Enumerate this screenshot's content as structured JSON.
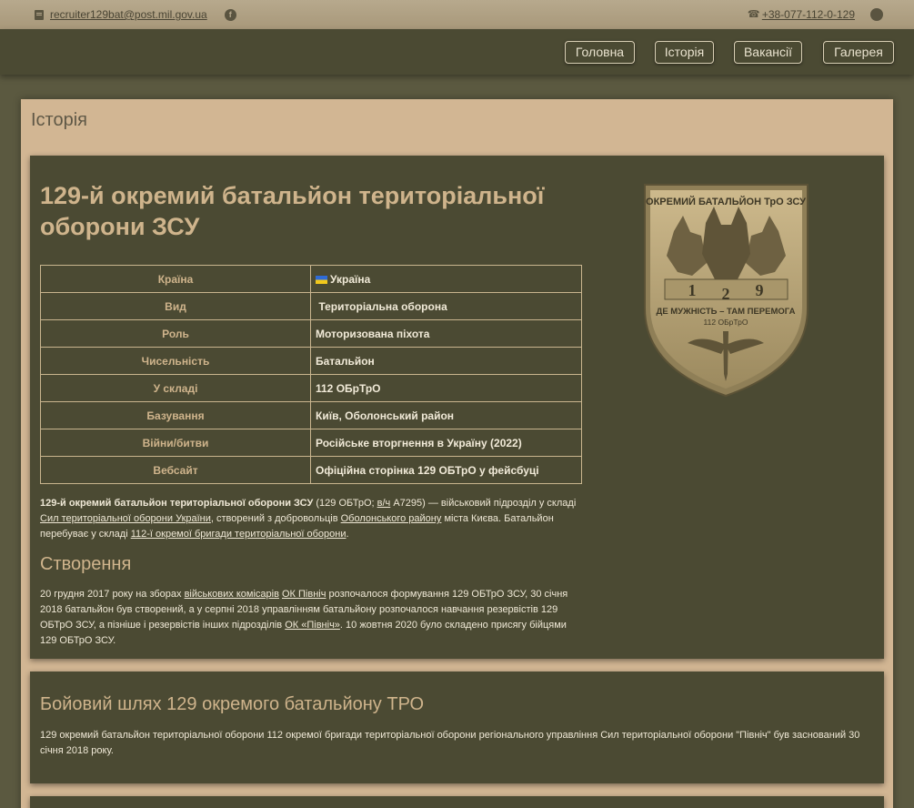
{
  "topbar": {
    "email": "recruiter129bat@post.mil.gov.ua",
    "phone": "+38-077-112-0-129",
    "icons": [
      "mail-icon",
      "facebook-icon",
      "phone-icon",
      "whatsapp-icon"
    ]
  },
  "nav": {
    "items": [
      "Головна",
      "Історія",
      "Вакансії",
      "Галерея"
    ]
  },
  "page_title": "Історія",
  "article": {
    "title": "129-й окремий батальйон територіальної оборони ЗСУ",
    "infobox": [
      {
        "key": "Країна",
        "value": "Україна"
      },
      {
        "key": "Вид",
        "value": "Територіальна оборона"
      },
      {
        "key": "Роль",
        "value": "Моторизована піхота"
      },
      {
        "key": "Чисельність",
        "value": "Батальйон"
      },
      {
        "key": "У складі",
        "value": "112 ОБрТрО"
      },
      {
        "key": "Базування",
        "value": "Київ, Оболонський район"
      },
      {
        "key": "Війни/битви",
        "value": "Російське вторгнення в Україну (2022)"
      },
      {
        "key": "Вебсайт",
        "value": "Офіційна сторінка 129 ОБТрО у фейсбуці"
      }
    ],
    "intro": {
      "bold": "129-й окремий батальйон територіальної оборони ЗСУ",
      "t1": " (129 ОБТрО; ",
      "l1": "в/ч",
      "t2": " А7295) — військовий підрозділ у складі ",
      "l2": "Сил територіальної оборони України",
      "t3": ", створений з добровольців ",
      "l3": "Оболонського району",
      "t4": " міста Києва. Батальйон перебуває у складі ",
      "l4": "112-ї окремої бригади територіальної оборони",
      "t5": "."
    },
    "section1_title": "Створення",
    "section1": {
      "t1": "20 грудня 2017 року на зборах ",
      "l1": "військових комісарів",
      "t2": " ",
      "l2": "ОК Північ",
      "t3": " розпочалося формування 129 ОБТрО ЗСУ, 30 січня 2018 батальйон був створений, а у серпні 2018 управлінням батальйону розпочалося навчання резервістів 129 ОБТрО ЗСУ, а пізніше і резервістів інших підрозділів ",
      "l3": "ОК «Північ»",
      "t4": ". 10 жовтня 2020 було складено присягу бійцями 129 ОБТрО ЗСУ."
    },
    "emblem": {
      "top_text": "ОКРЕМИЙ БАТАЛЬЙОН ТрО ЗСУ",
      "digits": [
        "1",
        "2",
        "9"
      ],
      "motto": "ДЕ МУЖНІСТЬ – ТАМ ПЕРЕМОГА",
      "sub": "112 ОБрТрО"
    }
  },
  "section2": {
    "title": "Бойовий шлях 129 окремого батальйону ТРО",
    "text": "129 окремий батальйон територіальної оборони 112 окремої бригади територіальної оборони регіонального управління Сил територіальної оборони \"Північ\" був заснований 30 січня 2018 року."
  }
}
